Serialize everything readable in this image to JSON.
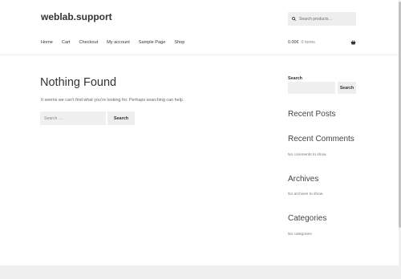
{
  "site": {
    "title": "weblab.support"
  },
  "header": {
    "search_placeholder": "Search products…",
    "nav": [
      "Home",
      "Cart",
      "Checkout",
      "My account",
      "Sample Page",
      "Shop"
    ],
    "cart": {
      "amount": "0.00€",
      "items": "0 items"
    }
  },
  "main": {
    "title": "Nothing Found",
    "message": "It seems we can’t find what you’re looking for. Perhaps searching can help.",
    "search_placeholder": "Search …",
    "search_button": "Search"
  },
  "sidebar": {
    "search_label": "Search",
    "search_button": "Search",
    "widgets": [
      {
        "title": "Recent Posts",
        "text": ""
      },
      {
        "title": "Recent Comments",
        "text": "No comments to show."
      },
      {
        "title": "Archives",
        "text": "No archives to show."
      },
      {
        "title": "Categories",
        "text": "No categories"
      }
    ]
  }
}
